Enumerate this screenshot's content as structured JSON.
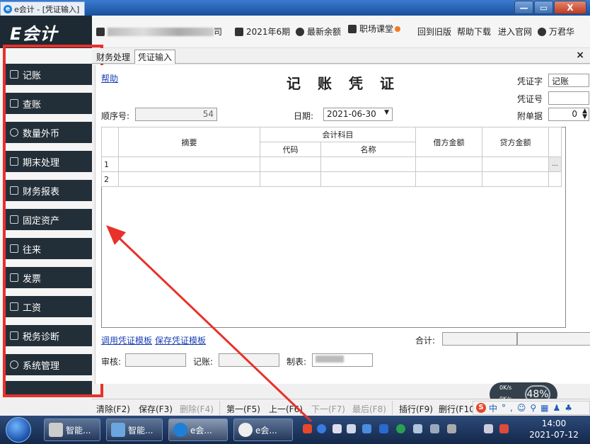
{
  "window": {
    "tab_title": "e会计 - [凭证输入]",
    "logo_letter": "e",
    "min_symbol": "—",
    "max_symbol": "▭",
    "close_symbol": "X"
  },
  "header": {
    "brand": "E会计",
    "company_suffix": "司",
    "period": "2021年6期",
    "balance": "最新余额",
    "classroom": "职场课堂",
    "links": [
      "回到旧版",
      "帮助下载",
      "进入官网"
    ],
    "user": "万君华"
  },
  "sidebar": {
    "items": [
      {
        "label": "记账",
        "icon": "edit-icon"
      },
      {
        "label": "查账",
        "icon": "search-ledger-icon"
      },
      {
        "label": "数量外币",
        "icon": "currency-icon"
      },
      {
        "label": "期末处理",
        "icon": "calendar-icon"
      },
      {
        "label": "财务报表",
        "icon": "report-icon"
      },
      {
        "label": "固定资产",
        "icon": "asset-icon"
      },
      {
        "label": "往来",
        "icon": "exchange-icon"
      },
      {
        "label": "发票",
        "icon": "invoice-icon"
      },
      {
        "label": "工资",
        "icon": "salary-icon"
      },
      {
        "label": "税务诊断",
        "icon": "tax-icon"
      },
      {
        "label": "系统管理",
        "icon": "gear-icon"
      }
    ]
  },
  "tabs": [
    "财务处理",
    "凭证输入"
  ],
  "tab_close": "×",
  "voucher": {
    "help": "帮助",
    "title": "记账凭证",
    "voucher_word_label": "凭证字",
    "voucher_word_value": "记账",
    "voucher_no_label": "凭证号",
    "voucher_no_value": "",
    "seq_label": "顺序号:",
    "seq_value": "54",
    "date_label": "日期:",
    "date_value": "2021-06-30",
    "attach_label": "附单据",
    "attach_value": "0",
    "columns": {
      "summary": "摘要",
      "account": "会计科目",
      "code": "代码",
      "name": "名称",
      "debit": "借方金额",
      "credit": "贷方金额"
    },
    "rows": [
      "1",
      "2"
    ],
    "ellipsis": "...",
    "template_call": "调用凭证模板",
    "template_save": "保存凭证模板",
    "total_label": "合计:",
    "audit_label": "审核:",
    "post_label": "记账:",
    "maker_label": "制表:",
    "maker_value": ""
  },
  "toolbar": {
    "buttons": [
      {
        "label": "清除(F2)",
        "enabled": true
      },
      {
        "label": "保存(F3)",
        "enabled": true
      },
      {
        "label": "删除(F4)",
        "enabled": false
      },
      {
        "label": "第一(F5)",
        "enabled": true
      },
      {
        "label": "上一(F6)",
        "enabled": true
      },
      {
        "label": "下一(F7)",
        "enabled": false
      },
      {
        "label": "最后(F8)",
        "enabled": false
      },
      {
        "label": "插行(F9)",
        "enabled": true
      },
      {
        "label": "删行(F10)",
        "enabled": true
      }
    ]
  },
  "net_widget": {
    "up": "0K/s",
    "down": "0K/s",
    "percent": "48%"
  },
  "ime": {
    "lang": "中"
  },
  "taskbar": {
    "tasks": [
      {
        "label": "智能..."
      },
      {
        "label": "智能..."
      },
      {
        "label": "e会..."
      },
      {
        "label": "e会..."
      }
    ],
    "time": "14:00",
    "date": "2021-07-12"
  },
  "colors": {
    "sidebar_bg": "#232f38",
    "highlight_box": "#e8312a",
    "link": "#1a3fb5"
  }
}
